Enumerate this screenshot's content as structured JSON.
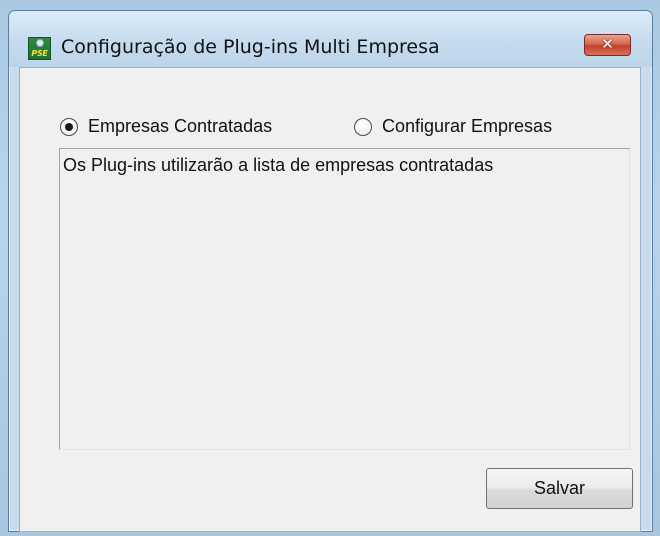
{
  "window": {
    "title": "Configuração de Plug-ins Multi Empresa",
    "app_icon_label": "PSE",
    "close_glyph": "✕"
  },
  "options": {
    "radio_contracted": {
      "label": "Empresas Contratadas",
      "checked": true
    },
    "radio_configure": {
      "label": "Configurar Empresas",
      "checked": false
    }
  },
  "message": {
    "text": "Os Plug-ins utilizarão a lista de empresas contratadas"
  },
  "actions": {
    "save_label": "Salvar"
  },
  "icons": {
    "app": "pse-app-icon",
    "close": "close-icon"
  },
  "colors": {
    "close_button": "#c2402a",
    "window_frame": "#c8dcee",
    "client_background": "#f0f0f0"
  }
}
